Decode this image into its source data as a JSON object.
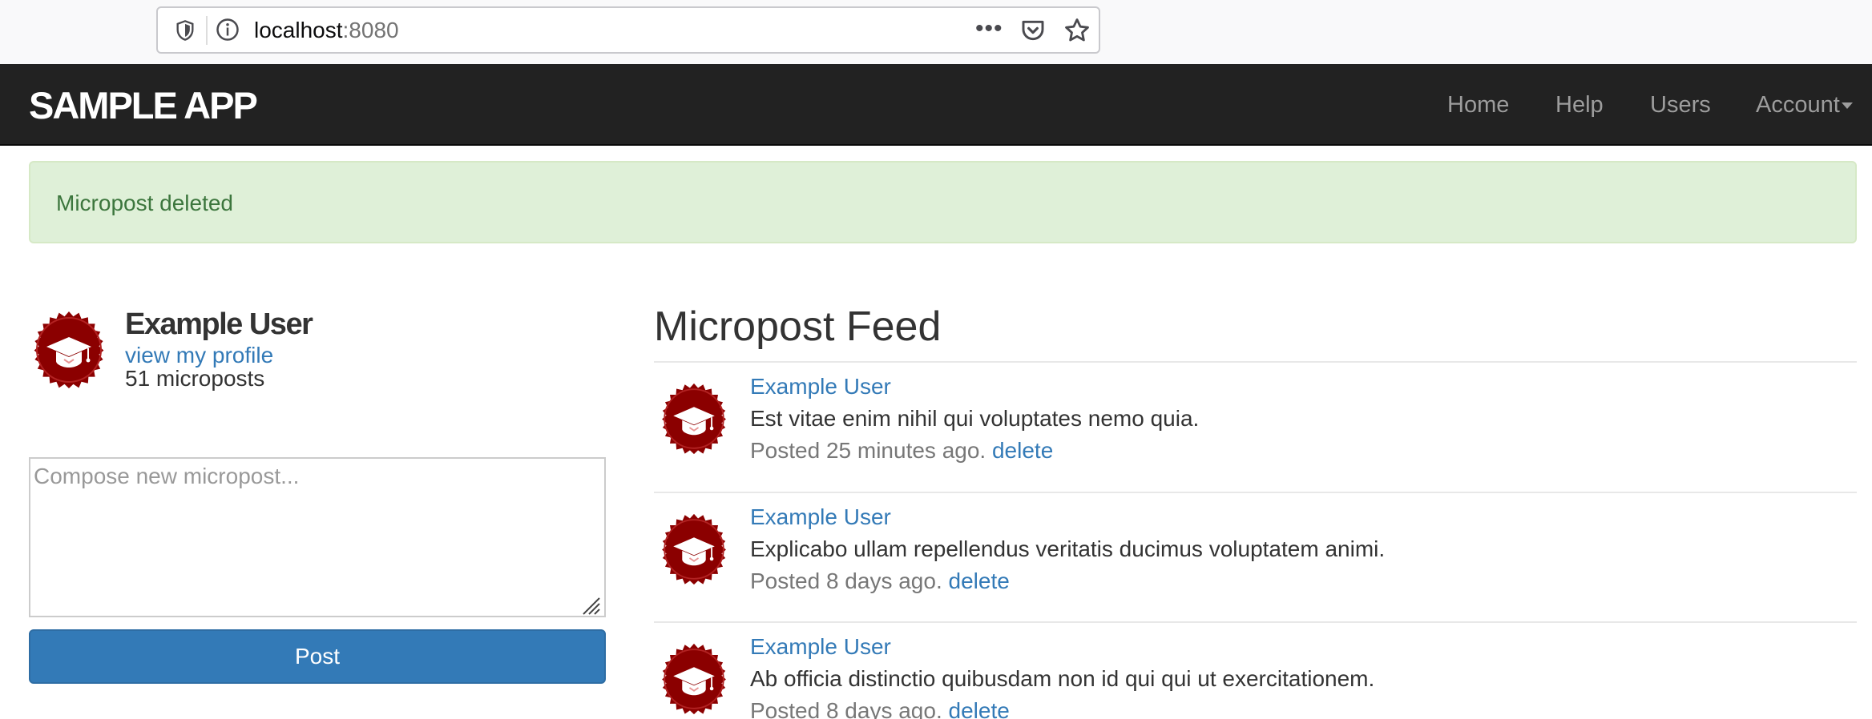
{
  "browser": {
    "url_host": "localhost",
    "url_port": ":8080",
    "menu_dots": "•••"
  },
  "navbar": {
    "brand": "SAMPLE APP",
    "links": [
      {
        "label": "Home"
      },
      {
        "label": "Help"
      },
      {
        "label": "Users"
      },
      {
        "label": "Account"
      }
    ]
  },
  "flash": {
    "message": "Micropost deleted"
  },
  "sidebar": {
    "user_name": "Example User",
    "profile_link": "view my profile",
    "post_count": "51 microposts",
    "compose_placeholder": "Compose new micropost...",
    "post_button": "Post"
  },
  "feed": {
    "title": "Micropost Feed",
    "items": [
      {
        "user": "Example User",
        "content": "Est vitae enim nihil qui voluptates nemo quia.",
        "posted": "Posted 25 minutes ago.",
        "delete": "delete"
      },
      {
        "user": "Example User",
        "content": "Explicabo ullam repellendus veritatis ducimus voluptatem animi.",
        "posted": "Posted 8 days ago.",
        "delete": "delete"
      },
      {
        "user": "Example User",
        "content": "Ab officia distinctio quibusdam non id qui qui ut exercitationem.",
        "posted": "Posted 8 days ago.",
        "delete": "delete"
      }
    ]
  },
  "colors": {
    "navbar_bg": "#222222",
    "link": "#337ab7",
    "alert_bg": "#dff0d8",
    "alert_text": "#3c763d",
    "avatar_red": "#8b0000"
  }
}
